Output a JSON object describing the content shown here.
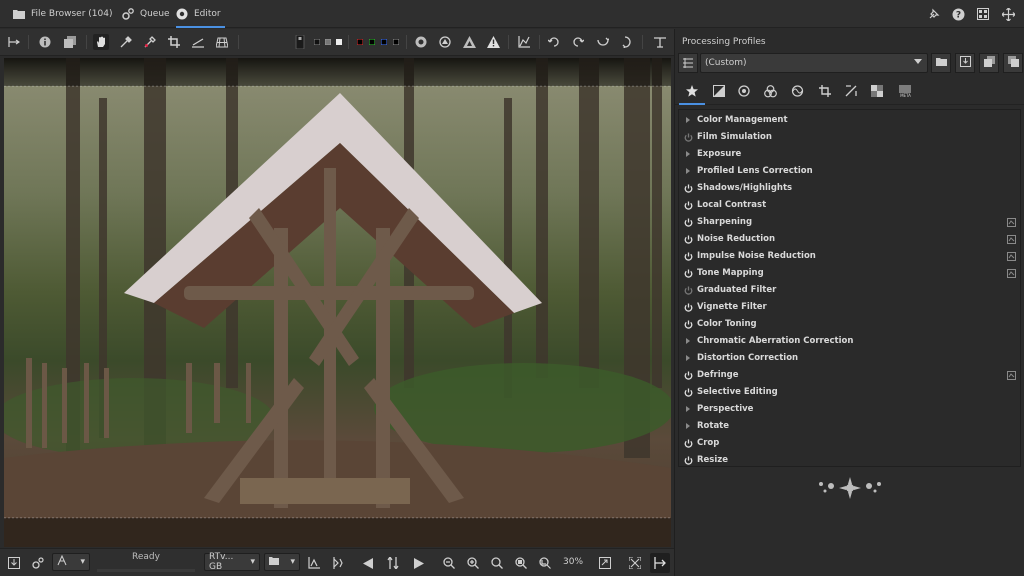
{
  "tabs": [
    {
      "label": "File Browser (104)",
      "icon": "folder-icon"
    },
    {
      "label": "Queue",
      "icon": "gears-icon"
    },
    {
      "label": "Editor",
      "icon": "editor-aperture-icon",
      "active": true
    }
  ],
  "top_right_icons": [
    "pin-icon",
    "help-icon",
    "panels-icon",
    "fullscreen-icon"
  ],
  "toolbar_icons": [
    "hide-side-panel-icon",
    "info-icon",
    "history-icon",
    "hand-tool-icon",
    "color-picker-icon",
    "white-balance-picker-icon",
    "crop-tool-icon",
    "straighten-tool-icon",
    "perspective-tool-icon",
    "before-after-icon",
    "bg-black-icon",
    "bg-grey-icon",
    "bg-white-icon",
    "channel-red-icon",
    "channel-green-icon",
    "channel-blue-icon",
    "channel-luminance-icon",
    "focus-mask-icon",
    "soft-proof-icon",
    "clip-highlights-icon",
    "clip-shadows-icon",
    "histogram-icon",
    "rotate-left-icon",
    "rotate-right-icon",
    "flip-horizontal-icon",
    "flip-vertical-icon",
    "snapshot-icon"
  ],
  "status": {
    "ready_label": "Ready",
    "profile_combo": "RTv... GB",
    "zoom_value": "30%"
  },
  "profiles": {
    "title": "Processing Profiles",
    "selected": "(Custom)"
  },
  "tool_tabs": [
    "favorites-tab-icon",
    "exposure-tab-icon",
    "detail-tab-icon",
    "color-tab-icon",
    "wavelet-tab-icon",
    "transform-tab-icon",
    "raw-tab-icon",
    "local-tab-icon",
    "meta-tab-icon"
  ],
  "tools": [
    {
      "name": "Color Management",
      "lead": "arrow",
      "right": ""
    },
    {
      "name": "Film Simulation",
      "lead": "power-off",
      "right": ""
    },
    {
      "name": "Exposure",
      "lead": "arrow",
      "right": ""
    },
    {
      "name": "Profiled Lens Correction",
      "lead": "arrow",
      "right": ""
    },
    {
      "name": "Shadows/Highlights",
      "lead": "power",
      "right": ""
    },
    {
      "name": "Local Contrast",
      "lead": "power",
      "right": ""
    },
    {
      "name": "Sharpening",
      "lead": "power",
      "right": "preview"
    },
    {
      "name": "Noise Reduction",
      "lead": "power",
      "right": "preview"
    },
    {
      "name": "Impulse Noise Reduction",
      "lead": "power",
      "right": "preview"
    },
    {
      "name": "Tone Mapping",
      "lead": "power",
      "right": "preview"
    },
    {
      "name": "Graduated Filter",
      "lead": "power-off",
      "right": ""
    },
    {
      "name": "Vignette Filter",
      "lead": "power",
      "right": ""
    },
    {
      "name": "Color Toning",
      "lead": "power",
      "right": ""
    },
    {
      "name": "Chromatic Aberration Correction",
      "lead": "arrow",
      "right": ""
    },
    {
      "name": "Distortion Correction",
      "lead": "arrow",
      "right": ""
    },
    {
      "name": "Defringe",
      "lead": "power",
      "right": "preview"
    },
    {
      "name": "Selective Editing",
      "lead": "power",
      "right": ""
    },
    {
      "name": "Perspective",
      "lead": "arrow",
      "right": ""
    },
    {
      "name": "Rotate",
      "lead": "arrow",
      "right": ""
    },
    {
      "name": "Crop",
      "lead": "power",
      "right": ""
    },
    {
      "name": "Resize",
      "lead": "power",
      "right": ""
    }
  ],
  "colors": {
    "accent": "#4a90e2",
    "bg": "#2b2b2b"
  }
}
